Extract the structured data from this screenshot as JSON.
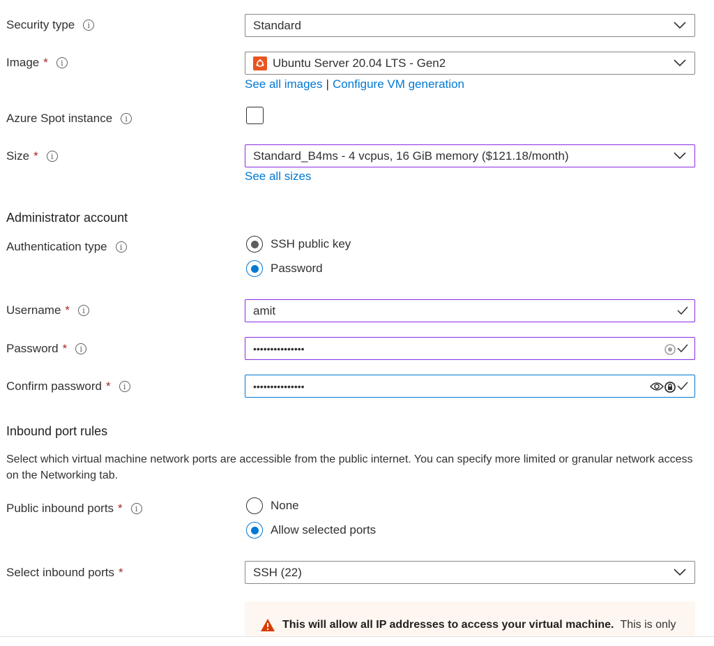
{
  "security_type": {
    "label": "Security type",
    "value": "Standard"
  },
  "image": {
    "label": "Image",
    "required": "*",
    "value": "Ubuntu Server 20.04 LTS - Gen2",
    "icon": "ubuntu-icon",
    "links": [
      "See all images",
      "Configure VM generation"
    ],
    "link_sep": "|"
  },
  "spot": {
    "label": "Azure Spot instance"
  },
  "size": {
    "label": "Size",
    "required": "*",
    "value": "Standard_B4ms - 4 vcpus, 16 GiB memory ($121.18/month)",
    "link": "See all sizes"
  },
  "admin": {
    "title": "Administrator account",
    "auth_label": "Authentication type",
    "auth_options": [
      "SSH public key",
      "Password"
    ],
    "auth_selected": "Password",
    "username_label": "Username",
    "username_value": "amit",
    "password_label": "Password",
    "password_value": "•••••••••••••••",
    "confirm_label": "Confirm password",
    "confirm_value": "•••••••••••••••",
    "required": "*"
  },
  "inbound": {
    "title": "Inbound port rules",
    "description": "Select which virtual machine network ports are accessible from the public internet. You can specify more limited or granular network access on the Networking tab.",
    "public_label": "Public inbound ports",
    "public_options": [
      "None",
      "Allow selected ports"
    ],
    "public_selected": "Allow selected ports",
    "select_label": "Select inbound ports",
    "select_value": "SSH (22)",
    "required": "*"
  },
  "warning": {
    "bold": "This will allow all IP addresses to access your virtual machine.",
    "text": "This is only"
  },
  "info_glyph": "i",
  "colors": {
    "link": "#0078d4",
    "required": "#a4262c",
    "focus_border": "#8a2be2",
    "active_border": "#0078d4",
    "warning_bg": "#fef7f1",
    "warning_icon": "#d83b01"
  }
}
